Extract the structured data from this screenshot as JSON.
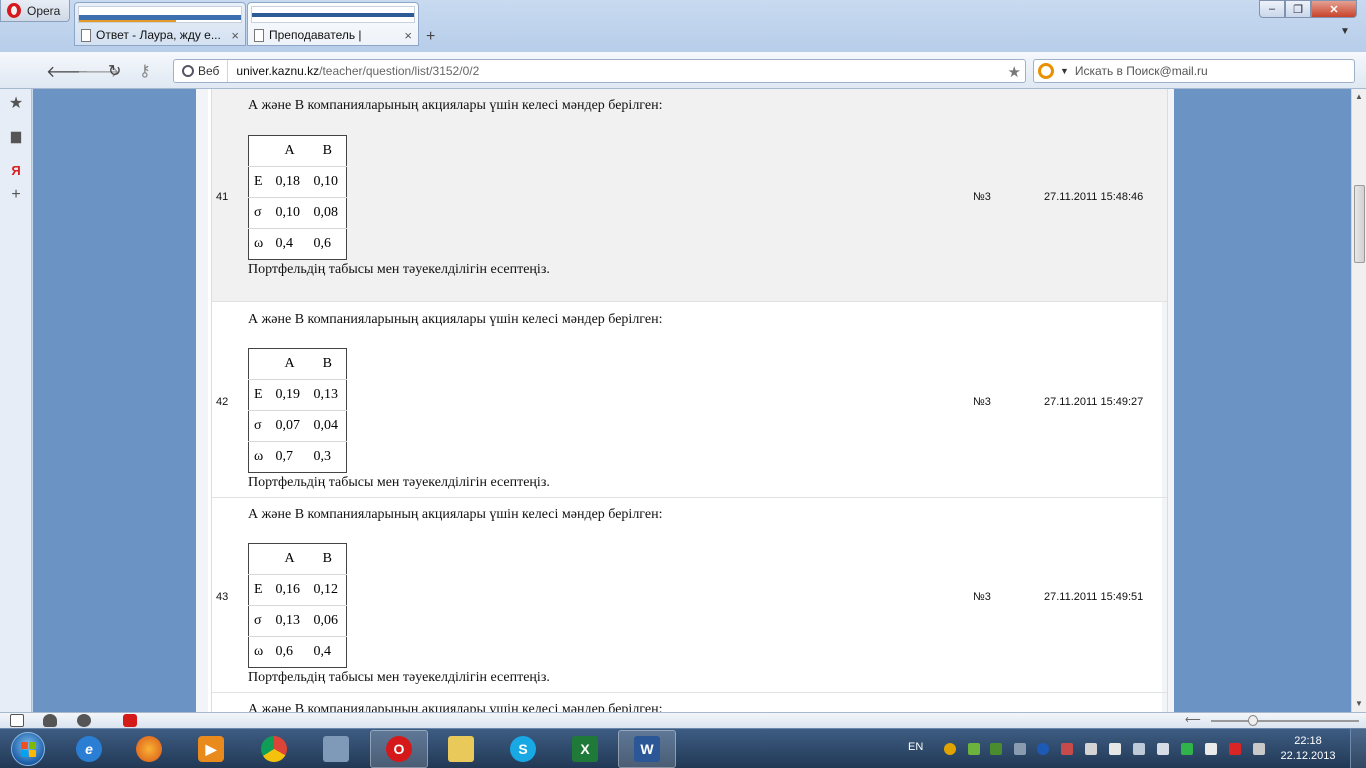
{
  "browser": {
    "menu_label": "Opera",
    "tabs": [
      {
        "label": "Ответ - Лаура, жду е...",
        "close": "×"
      },
      {
        "label": "Преподаватель |",
        "close": "×"
      }
    ],
    "new_tab": "+",
    "window_controls": {
      "minimize": "–",
      "maximize": "❐",
      "close": "✕"
    }
  },
  "navbar": {
    "web_badge": "Веб",
    "url_domain": "univer.kaznu.kz",
    "url_path": "/teacher/question/list/3152/0/2",
    "search_placeholder": "Искать в Поиск@mail.ru"
  },
  "table_headers": {
    "col_a": "A",
    "col_b": "B",
    "row_e": "E",
    "row_sigma": "σ",
    "row_omega": "ω"
  },
  "questions": [
    {
      "num": "41",
      "intro": "А және В компанияларының акциялары үшін келесі мәндер берілген:",
      "e": [
        "0,18",
        "0,10"
      ],
      "sigma": [
        "0,10",
        "0,08"
      ],
      "omega": [
        "0,4",
        "0,6"
      ],
      "outro": "Портфельдің табысы мен тәуекелділігін есептеңіз.",
      "variant": "№3",
      "datetime": "27.11.2011 15:48:46"
    },
    {
      "num": "42",
      "intro": "А және В компанияларының акциялары үшін келесі мәндер берілген:",
      "e": [
        "0,19",
        "0,13"
      ],
      "sigma": [
        "0,07",
        "0,04"
      ],
      "omega": [
        "0,7",
        "0,3"
      ],
      "outro": "Портфельдің табысы мен тәуекелділігін есептеңіз.",
      "variant": "№3",
      "datetime": "27.11.2011 15:49:27"
    },
    {
      "num": "43",
      "intro": "А және В компанияларының акциялары үшін келесі мәндер берілген:",
      "e": [
        "0,16",
        "0,12"
      ],
      "sigma": [
        "0,13",
        "0,06"
      ],
      "omega": [
        "0,6",
        "0,4"
      ],
      "outro": "Портфельдің табысы мен тәуекелділігін есептеңіз.",
      "variant": "№3",
      "datetime": "27.11.2011 15:49:51"
    }
  ],
  "partial_row_text": "А және В компанияларының акциялары үшін келесі мәндер берілген:",
  "taskbar": {
    "language": "EN",
    "time": "22:18",
    "date": "22.12.2013"
  }
}
